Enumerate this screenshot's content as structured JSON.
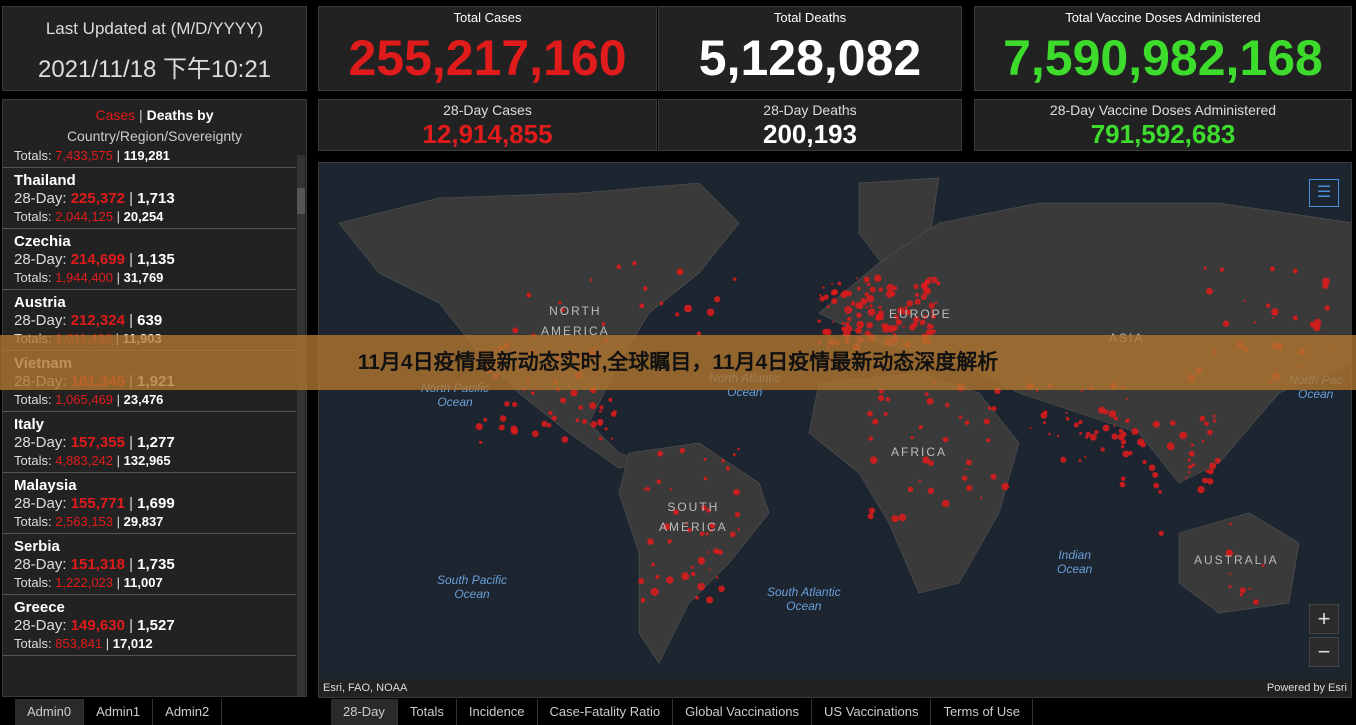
{
  "last_updated": {
    "title": "Last Updated at (M/D/YYYY)",
    "value": "2021/11/18 下午10:21"
  },
  "stats": [
    {
      "label": "Total Cases",
      "value": "255,217,160",
      "color": "#e01b1b"
    },
    {
      "label": "Total Deaths",
      "value": "5,128,082",
      "color": "#ffffff"
    },
    {
      "label": "Total Vaccine Doses Administered",
      "value": "7,590,982,168",
      "color": "#3ddc2c"
    }
  ],
  "stats28": [
    {
      "label": "28-Day Cases",
      "value": "12,914,855",
      "color": "#e01b1b"
    },
    {
      "label": "28-Day Deaths",
      "value": "200,193",
      "color": "#ffffff"
    },
    {
      "label": "28-Day Vaccine Doses Administered",
      "value": "791,592,683",
      "color": "#3ddc2c"
    }
  ],
  "list": {
    "title_cases": "Cases",
    "sep": " | ",
    "title_deaths": "Deaths by",
    "subtitle": "Country/Region/Sovereignty",
    "d_label": "28-Day: ",
    "t_label": "Totals: ",
    "partial": {
      "t_cases": "7,433,575",
      "t_deaths": "119,281"
    },
    "items": [
      {
        "name": "Thailand",
        "d_cases": "225,372",
        "d_deaths": "1,713",
        "t_cases": "2,044,125",
        "t_deaths": "20,254"
      },
      {
        "name": "Czechia",
        "d_cases": "214,699",
        "d_deaths": "1,135",
        "t_cases": "1,944,400",
        "t_deaths": "31,769"
      },
      {
        "name": "Austria",
        "d_cases": "212,324",
        "d_deaths": "639",
        "t_cases": "1,011,466",
        "t_deaths": "11,903"
      },
      {
        "name": "Vietnam",
        "d_cases": "181,345",
        "d_deaths": "1,921",
        "t_cases": "1,065,469",
        "t_deaths": "23,476"
      },
      {
        "name": "Italy",
        "d_cases": "157,355",
        "d_deaths": "1,277",
        "t_cases": "4,883,242",
        "t_deaths": "132,965"
      },
      {
        "name": "Malaysia",
        "d_cases": "155,771",
        "d_deaths": "1,699",
        "t_cases": "2,563,153",
        "t_deaths": "29,837"
      },
      {
        "name": "Serbia",
        "d_cases": "151,318",
        "d_deaths": "1,735",
        "t_cases": "1,222,023",
        "t_deaths": "11,007"
      },
      {
        "name": "Greece",
        "d_cases": "149,630",
        "d_deaths": "1,527",
        "t_cases": "853,841",
        "t_deaths": "17,012"
      }
    ]
  },
  "list_tabs": [
    "Admin0",
    "Admin1",
    "Admin2"
  ],
  "map": {
    "labels": {
      "na": "NORTH\nAMERICA",
      "eu": "EUROPE",
      "asia": "ASIA",
      "af": "AFRICA",
      "sa": "SOUTH\nAMERICA",
      "au": "AUSTRALIA"
    },
    "oceans": {
      "npac": "North Pacific\nOcean",
      "natl": "North Atlantic\nOcean",
      "npac2": "North Pac\nOcean",
      "spac": "South Pacific\nOcean",
      "satl": "South Atlantic\nOcean",
      "ind": "Indian\nOcean"
    },
    "attribution": "Esri, FAO, NOAA",
    "powered": "Powered by Esri",
    "zoom_in": "+",
    "zoom_out": "−",
    "legend_icon": "legend-list-icon"
  },
  "map_tabs": [
    "28-Day",
    "Totals",
    "Incidence",
    "Case-Fatality Ratio",
    "Global Vaccinations",
    "US Vaccinations",
    "Terms of Use"
  ],
  "banner": "11月4日疫情最新动态实时,全球瞩目，11月4日疫情最新动态深度解析"
}
